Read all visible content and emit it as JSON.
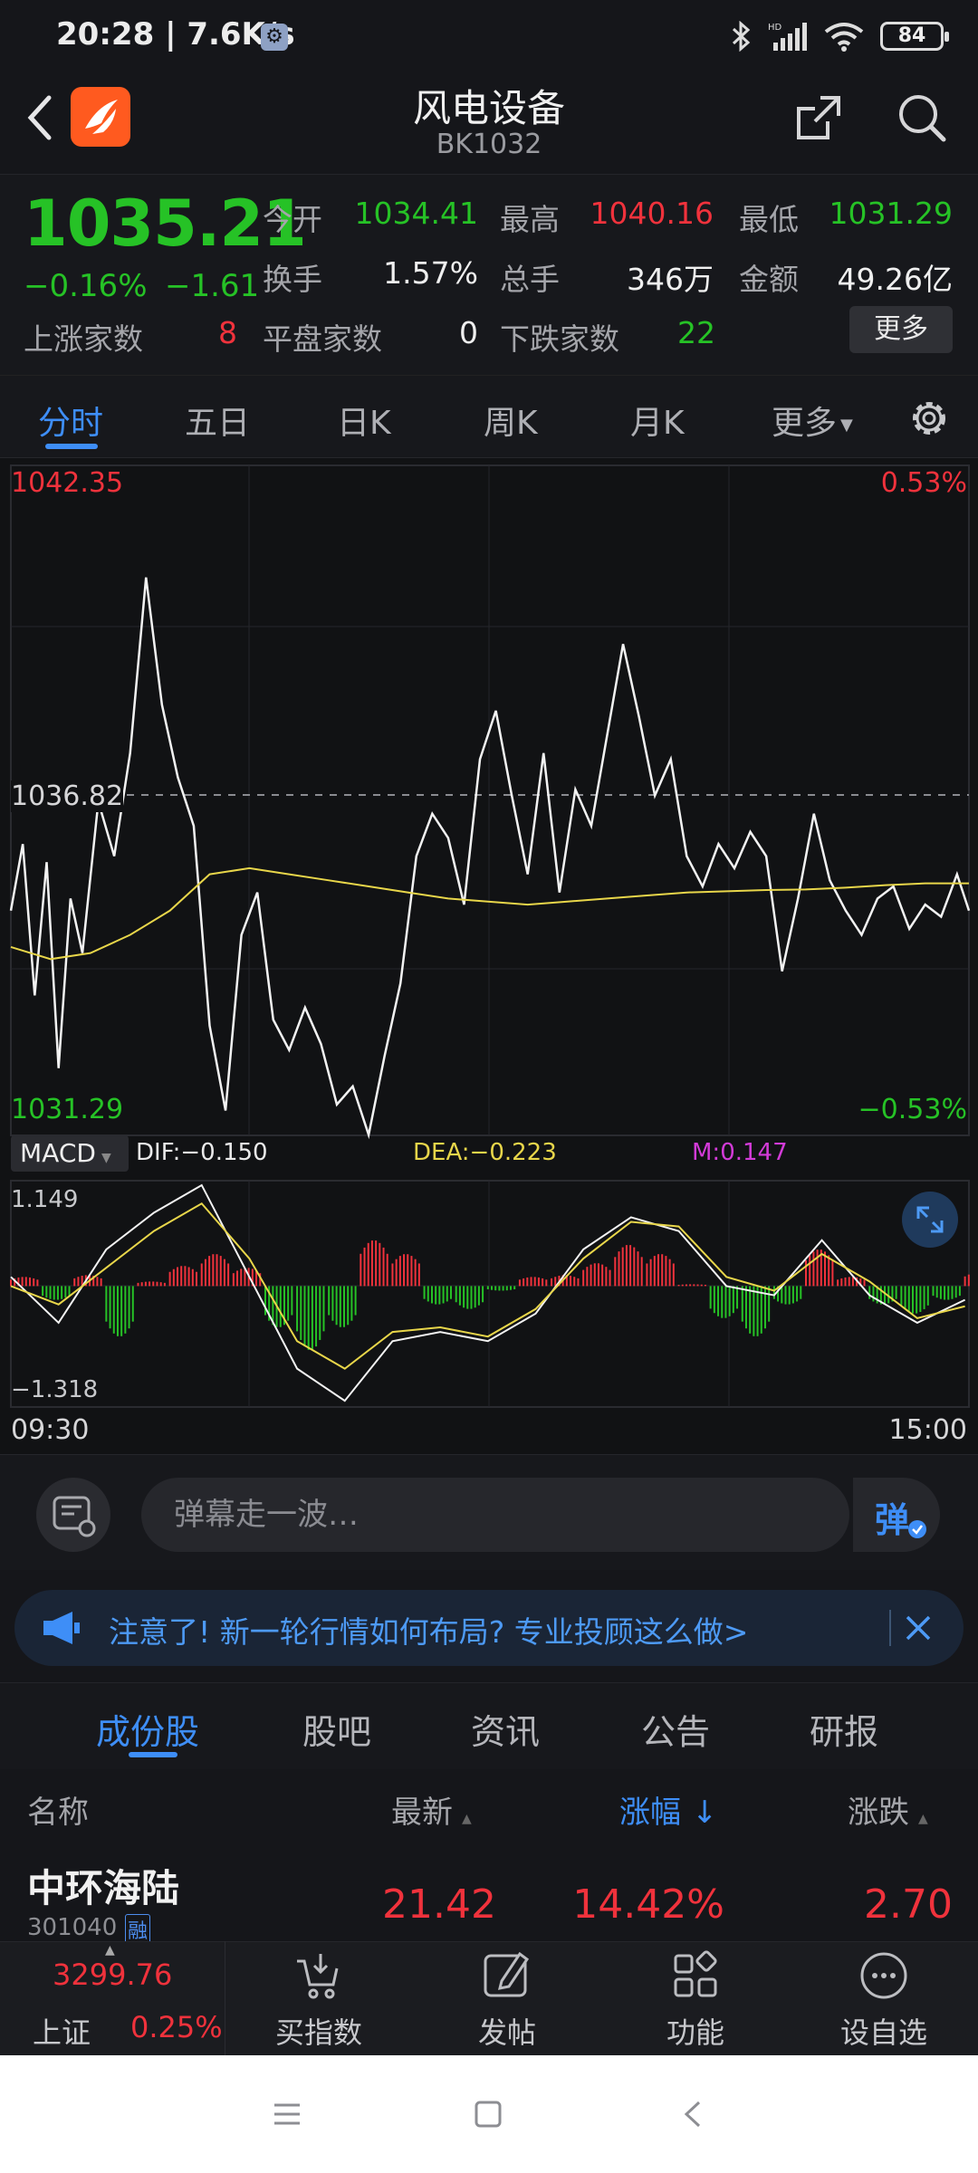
{
  "status_bar": {
    "time": "20:28 | 7.6K/s",
    "battery": "84"
  },
  "header": {
    "title": "风电设备",
    "code": "BK1032"
  },
  "quote": {
    "price": "1035.21",
    "change_pct": "−0.16%",
    "change": "−1.61",
    "rows": [
      {
        "label": "今开",
        "value": "1034.41",
        "color": "green"
      },
      {
        "label": "最高",
        "value": "1040.16",
        "color": "red"
      },
      {
        "label": "最低",
        "value": "1031.29",
        "color": "green"
      },
      {
        "label": "换手",
        "value": "1.57%",
        "color": "white"
      },
      {
        "label": "总手",
        "value": "346万",
        "color": "white"
      },
      {
        "label": "金额",
        "value": "49.26亿",
        "color": "white"
      }
    ],
    "up_label": "上涨家数",
    "up_value": "8",
    "flat_label": "平盘家数",
    "flat_value": "0",
    "down_label": "下跌家数",
    "down_value": "22",
    "more_button": "更多"
  },
  "period_tabs": [
    "分时",
    "五日",
    "日K",
    "周K",
    "月K",
    "更多"
  ],
  "chart_data": [
    {
      "type": "line",
      "title": "",
      "y_labels": {
        "top_left": "1042.35",
        "mid_left": "1036.82",
        "bottom_left": "1031.29",
        "top_right": "0.53%",
        "bottom_right": "−0.53%"
      },
      "ylim": [
        1031.29,
        1042.35
      ],
      "reference": 1036.82,
      "x_ticks": [
        "09:30",
        "15:00"
      ],
      "series": [
        {
          "color": "#f2f2f2",
          "x": [
            0,
            3,
            6,
            9,
            12,
            15,
            18,
            22,
            26,
            30,
            34,
            38,
            42,
            46,
            50,
            54,
            58,
            62,
            66,
            70,
            74,
            78,
            82,
            86,
            90,
            94,
            98,
            102,
            106,
            110,
            114,
            118,
            122,
            126,
            130,
            134,
            138,
            142,
            146,
            150,
            154,
            158,
            162,
            166,
            170,
            174,
            178,
            182,
            186,
            190,
            194,
            198,
            202,
            206,
            210,
            214,
            218,
            222,
            226,
            230,
            234,
            238,
            241
          ],
          "y": [
            1035.0,
            1036.1,
            1033.6,
            1035.8,
            1032.4,
            1035.2,
            1034.3,
            1036.8,
            1035.9,
            1037.6,
            1040.5,
            1038.4,
            1037.2,
            1036.4,
            1033.1,
            1031.7,
            1034.6,
            1035.3,
            1033.2,
            1032.7,
            1033.4,
            1032.8,
            1031.8,
            1032.1,
            1031.3,
            1032.6,
            1033.8,
            1035.9,
            1036.6,
            1036.2,
            1035.1,
            1037.5,
            1038.3,
            1036.9,
            1035.6,
            1037.6,
            1035.3,
            1037.0,
            1036.4,
            1037.9,
            1039.4,
            1038.2,
            1036.9,
            1037.5,
            1035.9,
            1035.4,
            1036.1,
            1035.7,
            1036.3,
            1035.9,
            1034.0,
            1035.2,
            1036.6,
            1035.5,
            1035.0,
            1034.6,
            1035.2,
            1035.4,
            1034.7,
            1035.1,
            1034.9,
            1035.6,
            1035.0
          ]
        },
        {
          "color": "#e8d64a",
          "x": [
            0,
            10,
            20,
            30,
            40,
            50,
            60,
            70,
            80,
            90,
            100,
            110,
            120,
            130,
            140,
            150,
            160,
            170,
            180,
            190,
            200,
            210,
            220,
            230,
            241
          ],
          "y": [
            1034.4,
            1034.2,
            1034.3,
            1034.6,
            1035.0,
            1035.6,
            1035.7,
            1035.6,
            1035.5,
            1035.4,
            1035.3,
            1035.2,
            1035.15,
            1035.1,
            1035.15,
            1035.2,
            1035.25,
            1035.3,
            1035.32,
            1035.34,
            1035.35,
            1035.38,
            1035.42,
            1035.45,
            1035.45
          ]
        }
      ]
    },
    {
      "type": "bar",
      "title": "",
      "indicator": "MACD",
      "dif_label": "DIF:−0.150",
      "dea_label": "DEA:−0.223",
      "m_label": "M:0.147",
      "ylim": [
        -1.318,
        1.149
      ],
      "y_labels": {
        "top": "1.149",
        "bottom": "−1.318"
      },
      "hist_x": [
        0,
        8,
        16,
        24,
        32,
        40,
        48,
        56,
        64,
        72,
        80,
        88,
        96,
        104,
        112,
        120,
        128,
        136,
        144,
        152,
        160,
        168,
        176,
        184,
        192,
        200,
        208,
        216,
        224,
        232,
        240
      ],
      "hist": [
        0.1,
        -0.15,
        0.12,
        -0.55,
        0.05,
        0.22,
        0.35,
        0.2,
        -0.45,
        -0.7,
        -0.45,
        0.5,
        0.35,
        -0.2,
        -0.25,
        -0.05,
        0.1,
        0.12,
        0.25,
        0.45,
        0.35,
        0.02,
        -0.35,
        -0.55,
        -0.2,
        0.4,
        0.1,
        -0.2,
        -0.3,
        -0.15,
        0.15
      ],
      "series": [
        {
          "name": "DIF",
          "color": "#f2f2f2",
          "x": [
            0,
            12,
            24,
            36,
            48,
            60,
            72,
            84,
            96,
            108,
            120,
            132,
            144,
            156,
            168,
            180,
            192,
            204,
            216,
            228,
            240
          ],
          "y": [
            0.1,
            -0.4,
            0.4,
            0.8,
            1.1,
            0.1,
            -0.9,
            -1.25,
            -0.6,
            -0.5,
            -0.6,
            -0.3,
            0.4,
            0.75,
            0.6,
            0.0,
            -0.1,
            0.5,
            -0.1,
            -0.4,
            -0.15
          ]
        },
        {
          "name": "DEA",
          "color": "#e8d64a",
          "x": [
            0,
            12,
            24,
            36,
            48,
            60,
            72,
            84,
            96,
            108,
            120,
            132,
            144,
            156,
            168,
            180,
            192,
            204,
            216,
            228,
            240
          ],
          "y": [
            0.0,
            -0.2,
            0.2,
            0.6,
            0.9,
            0.3,
            -0.6,
            -0.9,
            -0.5,
            -0.45,
            -0.55,
            -0.25,
            0.3,
            0.7,
            0.65,
            0.1,
            -0.05,
            0.35,
            0.05,
            -0.35,
            -0.22
          ]
        }
      ]
    }
  ],
  "danmu": {
    "placeholder": "弹幕走一波…",
    "button": "弹"
  },
  "notice": {
    "text": "注意了! 新一轮行情如何布局? 专业投顾这么做>"
  },
  "section_tabs": [
    "成份股",
    "股吧",
    "资讯",
    "公告",
    "研报"
  ],
  "table": {
    "headers": {
      "name": "名称",
      "latest": "最新",
      "pct": "涨幅",
      "change": "涨跌"
    },
    "rows": [
      {
        "name": "中环海陆",
        "code": "301040",
        "tag": "融",
        "latest": "21.42",
        "pct": "14.42%",
        "change": "2.70"
      }
    ]
  },
  "bottom_nav": {
    "index_value": "3299.76",
    "index_name": "上证",
    "index_pct": "0.25%",
    "items": [
      "买指数",
      "发帖",
      "功能",
      "设自选"
    ]
  },
  "colors": {
    "up": "#f0323c",
    "down": "#26c226",
    "accent": "#3e8ef7",
    "dea": "#e8d64a",
    "m": "#d33bd8"
  }
}
